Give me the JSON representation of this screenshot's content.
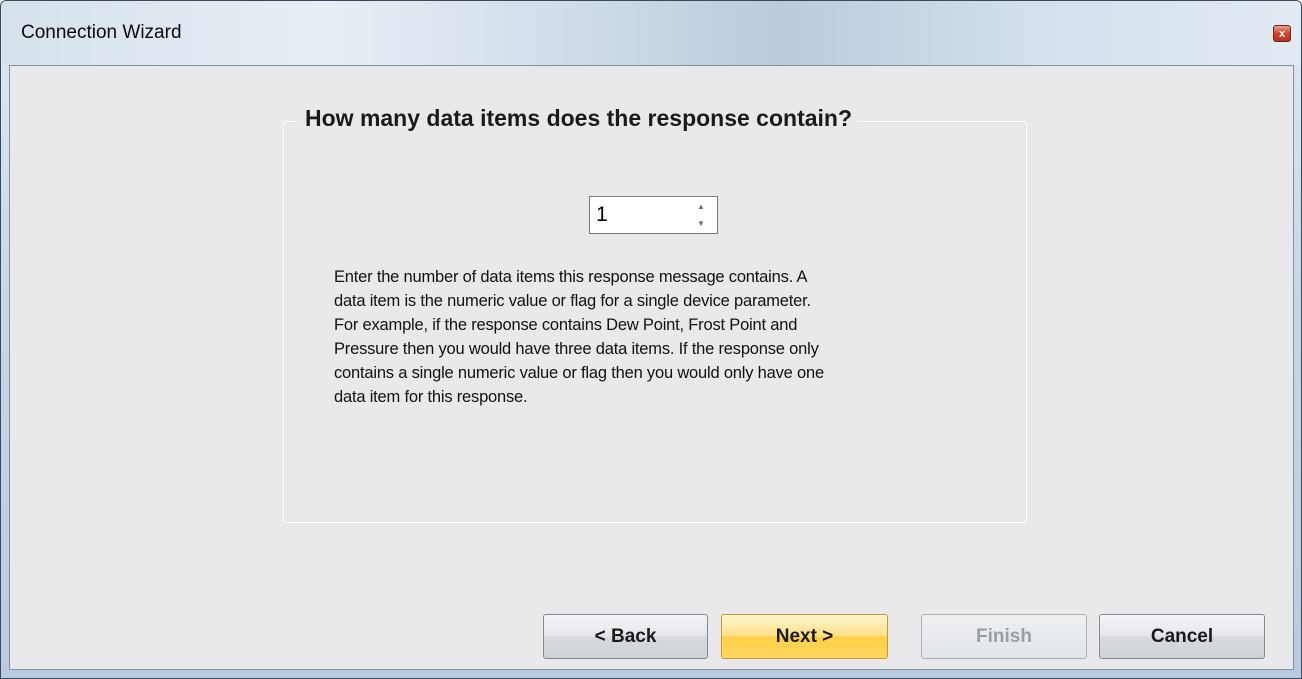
{
  "window": {
    "title": "Connection Wizard",
    "close_glyph": "x"
  },
  "group": {
    "title": "How many data items does the response contain?"
  },
  "stepper": {
    "value": "1",
    "up_glyph": "▲",
    "down_glyph": "▼"
  },
  "description": "Enter the number of data items this response message contains.  A\ndata item is the numeric value or flag for a single device parameter.\nFor example, if the response contains Dew Point, Frost Point and\nPressure then you would have three data items.  If the response only\ncontains a single numeric value or flag then you would only have one\ndata item for this response.",
  "buttons": {
    "back": "< Back",
    "next": "Next >",
    "finish": "Finish",
    "cancel": "Cancel"
  }
}
